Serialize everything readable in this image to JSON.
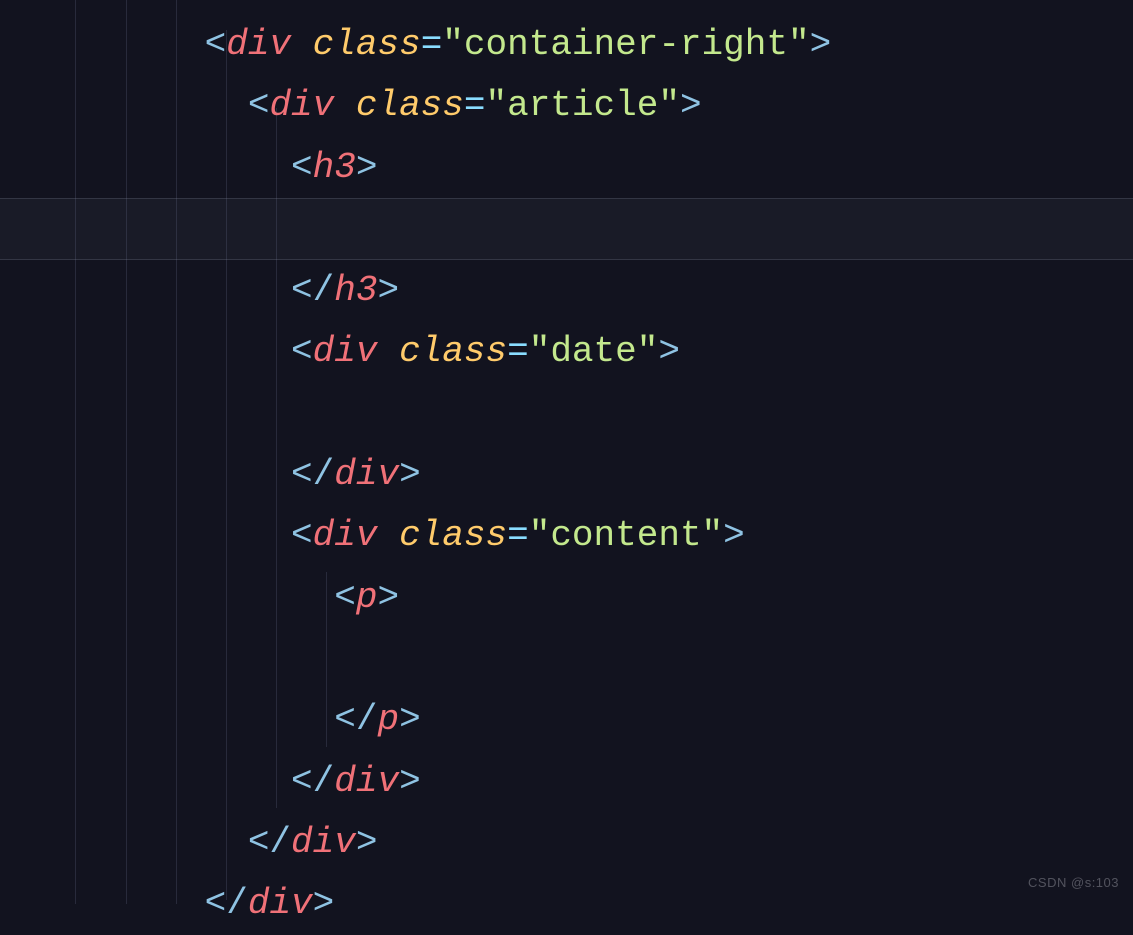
{
  "code": {
    "lines": [
      {
        "indent": 3,
        "tokens": [
          {
            "cls": "bracket",
            "text": "<"
          },
          {
            "cls": "tag",
            "text": "div"
          },
          {
            "cls": "",
            "text": " "
          },
          {
            "cls": "attr",
            "text": "class"
          },
          {
            "cls": "eq",
            "text": "="
          },
          {
            "cls": "string",
            "text": "\"container-right\""
          },
          {
            "cls": "bracket",
            "text": ">"
          }
        ]
      },
      {
        "indent": 4,
        "tokens": [
          {
            "cls": "bracket",
            "text": "<"
          },
          {
            "cls": "tag",
            "text": "div"
          },
          {
            "cls": "",
            "text": " "
          },
          {
            "cls": "attr",
            "text": "class"
          },
          {
            "cls": "eq",
            "text": "="
          },
          {
            "cls": "string",
            "text": "\"article\""
          },
          {
            "cls": "bracket",
            "text": ">"
          }
        ]
      },
      {
        "indent": 5,
        "tokens": [
          {
            "cls": "bracket",
            "text": "<"
          },
          {
            "cls": "tag",
            "text": "h3"
          },
          {
            "cls": "bracket",
            "text": ">"
          }
        ]
      },
      {
        "indent": 0,
        "highlighted": true,
        "tokens": []
      },
      {
        "indent": 5,
        "tokens": [
          {
            "cls": "bracket",
            "text": "</"
          },
          {
            "cls": "tag",
            "text": "h3"
          },
          {
            "cls": "bracket",
            "text": ">"
          }
        ]
      },
      {
        "indent": 5,
        "tokens": [
          {
            "cls": "bracket",
            "text": "<"
          },
          {
            "cls": "tag",
            "text": "div"
          },
          {
            "cls": "",
            "text": " "
          },
          {
            "cls": "attr",
            "text": "class"
          },
          {
            "cls": "eq",
            "text": "="
          },
          {
            "cls": "string",
            "text": "\"date\""
          },
          {
            "cls": "bracket",
            "text": ">"
          }
        ]
      },
      {
        "indent": 0,
        "tokens": []
      },
      {
        "indent": 5,
        "tokens": [
          {
            "cls": "bracket",
            "text": "</"
          },
          {
            "cls": "tag",
            "text": "div"
          },
          {
            "cls": "bracket",
            "text": ">"
          }
        ]
      },
      {
        "indent": 5,
        "tokens": [
          {
            "cls": "bracket",
            "text": "<"
          },
          {
            "cls": "tag",
            "text": "div"
          },
          {
            "cls": "",
            "text": " "
          },
          {
            "cls": "attr",
            "text": "class"
          },
          {
            "cls": "eq",
            "text": "="
          },
          {
            "cls": "string",
            "text": "\"content\""
          },
          {
            "cls": "bracket",
            "text": ">"
          }
        ]
      },
      {
        "indent": 6,
        "tokens": [
          {
            "cls": "bracket",
            "text": "<"
          },
          {
            "cls": "tag",
            "text": "p"
          },
          {
            "cls": "bracket",
            "text": ">"
          }
        ]
      },
      {
        "indent": 0,
        "tokens": []
      },
      {
        "indent": 6,
        "tokens": [
          {
            "cls": "bracket",
            "text": "</"
          },
          {
            "cls": "tag",
            "text": "p"
          },
          {
            "cls": "bracket",
            "text": ">"
          }
        ]
      },
      {
        "indent": 5,
        "tokens": [
          {
            "cls": "bracket",
            "text": "</"
          },
          {
            "cls": "tag",
            "text": "div"
          },
          {
            "cls": "bracket",
            "text": ">"
          }
        ]
      },
      {
        "indent": 4,
        "tokens": [
          {
            "cls": "bracket",
            "text": "</"
          },
          {
            "cls": "tag",
            "text": "div"
          },
          {
            "cls": "bracket",
            "text": ">"
          }
        ]
      },
      {
        "indent": 3,
        "tokens": [
          {
            "cls": "bracket",
            "text": "</"
          },
          {
            "cls": "tag",
            "text": "div"
          },
          {
            "cls": "bracket",
            "text": ">"
          }
        ]
      }
    ]
  },
  "watermark": "CSDN @s:103",
  "indent_unit": "  "
}
